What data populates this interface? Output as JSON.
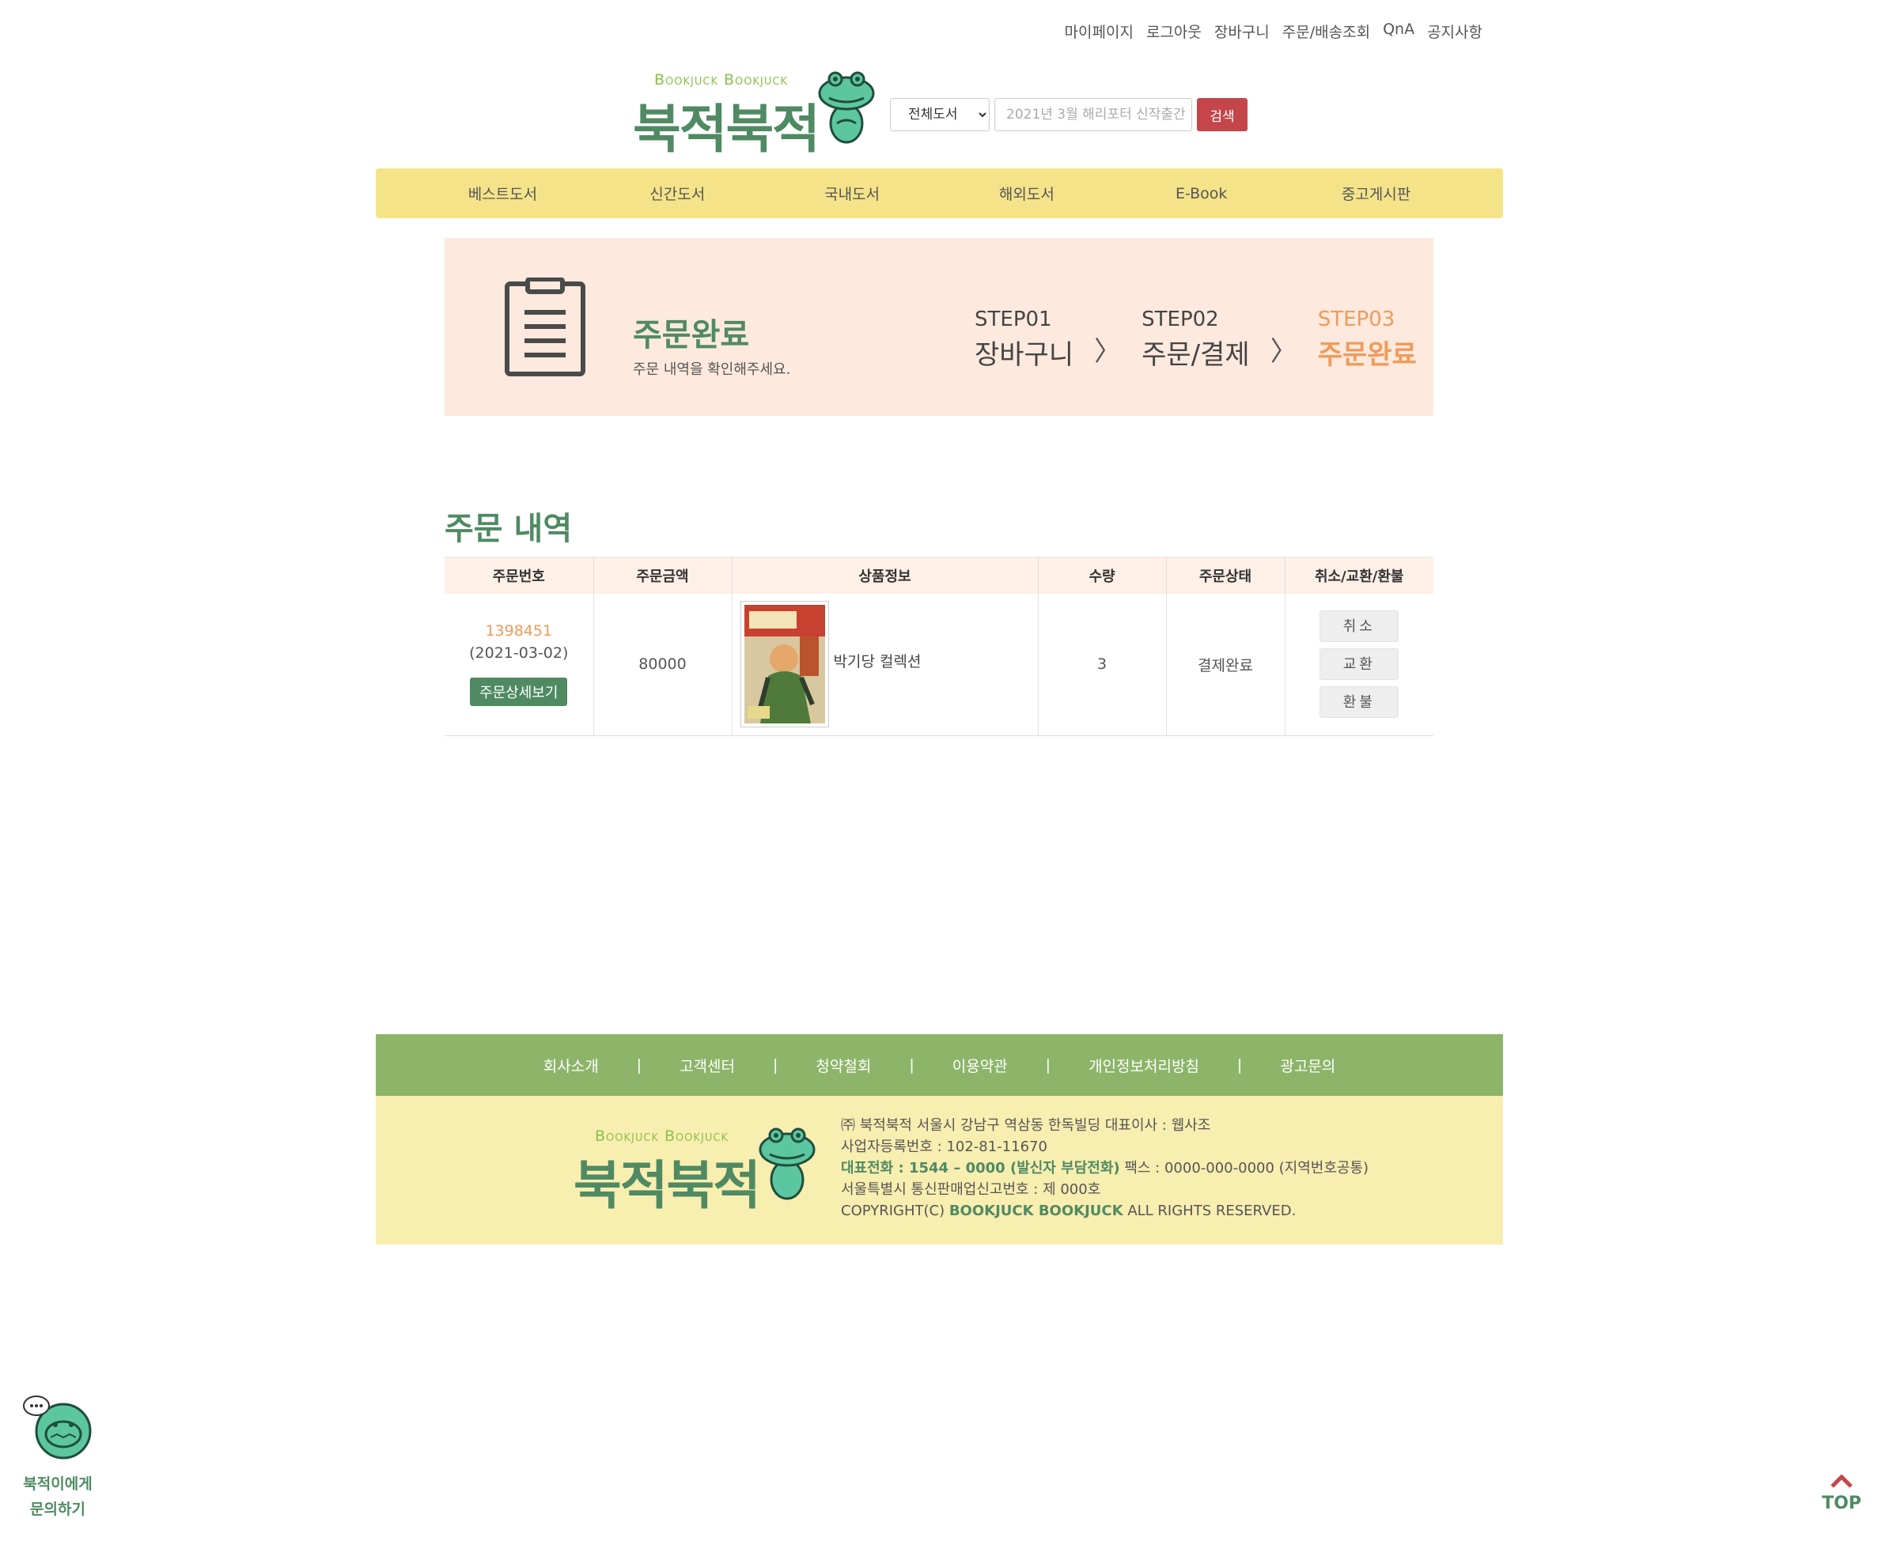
{
  "util_links": [
    "마이페이지",
    "로그아웃",
    "장바구니",
    "주문/배송조회",
    "QnA",
    "공지사항"
  ],
  "logo": {
    "en": "Bookjuck Bookjuck",
    "kr": "북적북적"
  },
  "search": {
    "category": "전체도서",
    "placeholder": "2021년 3월 해리포터 신작출간",
    "button": "검색"
  },
  "nav": [
    "베스트도서",
    "신간도서",
    "국내도서",
    "해외도서",
    "E-Book",
    "중고게시판"
  ],
  "banner": {
    "title": "주문완료",
    "subtitle": "주문 내역을 확인해주세요.",
    "steps": [
      {
        "num": "STEP01",
        "label": "장바구니"
      },
      {
        "num": "STEP02",
        "label": "주문/결제"
      },
      {
        "num": "STEP03",
        "label": "주문완료"
      }
    ],
    "arrow": "〉"
  },
  "orders": {
    "title": "주문 내역",
    "headers": [
      "주문번호",
      "주문금액",
      "상품정보",
      "수량",
      "주문상태",
      "취소/교환/환불"
    ],
    "row": {
      "order_no": "1398451",
      "date": "(2021-03-02)",
      "detail_button": "주문상세보기",
      "amount": "80000",
      "product_name": "박기당 컬렉션",
      "quantity": "3",
      "status": "결제완료",
      "actions": [
        "취소",
        "교환",
        "환불"
      ]
    }
  },
  "footer": {
    "links": [
      "회사소개",
      "고객센터",
      "청약철회",
      "이용약관",
      "개인정보처리방침",
      "광고문의"
    ],
    "sep": "|",
    "line1": "㈜ 북적북적   서울시 강남구 역삼동 한독빌딩   대표이사 : 웹사조",
    "line2": "사업자등록번호 : 102-81-11670",
    "line3_hl": "대표전화 : 1544 – 0000 (발신자 부담전화)",
    "line3_rest": "  팩스 : 0000-000-0000 (지역번호공통)",
    "line4": "서울특별시 통신판매업신고번호 : 제 000호",
    "line5_pre": "COPYRIGHT(C) ",
    "line5_hl": "BOOKJUCK BOOKJUCK",
    "line5_post": " ALL RIGHTS RESERVED."
  },
  "chat": {
    "line1": "북적이에게",
    "line2": "문의하기"
  },
  "top": {
    "label": "TOP"
  },
  "colors": {
    "green": "#4f8a63",
    "yellow": "#f5e38a",
    "orange": "#ef9b5b",
    "red": "#c4454a",
    "peach": "#fde9dd"
  }
}
